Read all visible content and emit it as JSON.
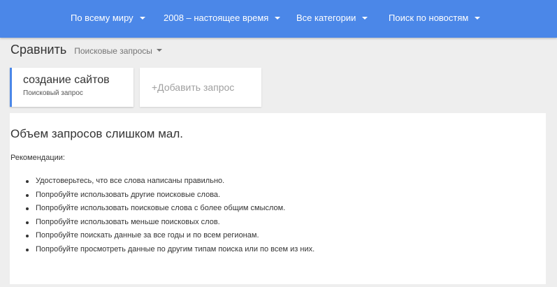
{
  "filters": [
    {
      "label": "По всему миру"
    },
    {
      "label": "2008 – настоящее время"
    },
    {
      "label": "Все категории"
    },
    {
      "label": "Поиск по новостям"
    }
  ],
  "compare": {
    "title": "Сравнить",
    "type_label": "Поисковые запросы"
  },
  "term_card": {
    "name": "создание сайтов",
    "subtitle": "Поисковый запрос"
  },
  "add_card": {
    "label": "+Добавить запрос"
  },
  "message": {
    "title": "Объем запросов слишком мал.",
    "recommendations_label": "Рекомендации:",
    "tips": [
      "Удостоверьтесь, что все слова написаны правильно.",
      "Попробуйте использовать другие поисковые слова.",
      "Попробуйте использовать поисковые слова с более общим смыслом.",
      "Попробуйте использовать меньше поисковых слов.",
      "Попробуйте поискать данные за все годы и по всем регионам.",
      "Попробуйте просмотреть данные по другим типам поиска или по всем из них."
    ]
  },
  "colors": {
    "topbar": "#4b87e8",
    "background": "#eeeeee",
    "accent": "#4b87e8"
  }
}
